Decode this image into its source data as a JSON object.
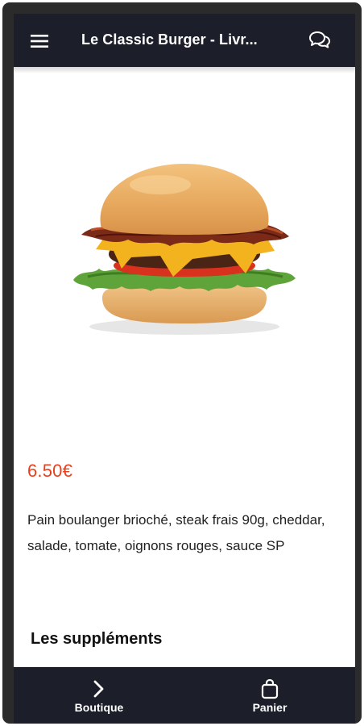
{
  "header": {
    "title": "Le Classic Burger - Livr...",
    "menu_icon": "hamburger-menu-icon",
    "chat_icon": "chat-bubbles-icon",
    "background": "#1c1f2a"
  },
  "product": {
    "image": "classic-burger-photo",
    "price": "6.50€",
    "price_color": "#e8401c",
    "description": "Pain boulanger brioché, steak frais 90g, cheddar, salade, tomate, oignons rouges, sauce SP",
    "supplements_title": "Les suppléments"
  },
  "bottom_nav": {
    "items": [
      {
        "label": "Boutique",
        "icon": "chevron-right-icon"
      },
      {
        "label": "Panier",
        "icon": "shopping-bag-icon"
      }
    ]
  }
}
